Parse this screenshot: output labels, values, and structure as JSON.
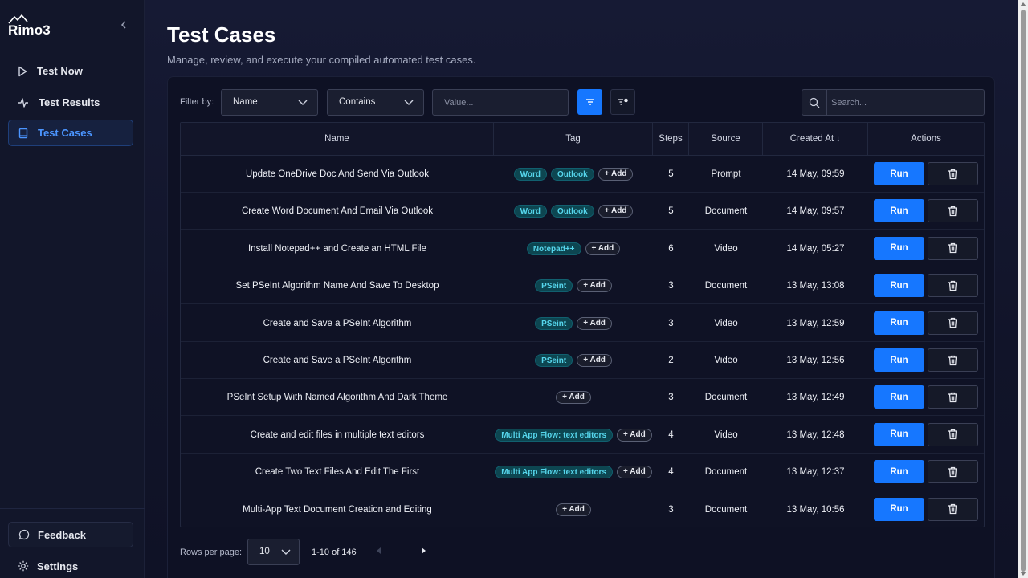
{
  "app": {
    "logo_text": "Rimo3"
  },
  "sidebar": {
    "items": [
      {
        "label": "Test Now",
        "icon": "play-icon"
      },
      {
        "label": "Test Results",
        "icon": "activity-icon"
      },
      {
        "label": "Test Cases",
        "icon": "book-icon",
        "active": true
      }
    ],
    "feedback_label": "Feedback",
    "settings_label": "Settings"
  },
  "header": {
    "title": "Test Cases",
    "subtitle": "Manage, review, and execute your compiled automated test cases."
  },
  "filter": {
    "label": "Filter by:",
    "field_value": "Name",
    "operator_value": "Contains",
    "value_placeholder": "Value...",
    "search_placeholder": "Search..."
  },
  "table": {
    "columns": [
      "Name",
      "Tag",
      "Steps",
      "Source",
      "Created At",
      "Actions"
    ],
    "sort_indicator": "↓",
    "add_tag_label": "+ Add",
    "run_label": "Run",
    "rows": [
      {
        "name": "Update OneDrive Doc And Send Via Outlook",
        "tags": [
          "Word",
          "Outlook"
        ],
        "steps": "5",
        "source": "Prompt",
        "created": "14 May, 09:59"
      },
      {
        "name": "Create Word Document And Email Via Outlook",
        "tags": [
          "Word",
          "Outlook"
        ],
        "steps": "5",
        "source": "Document",
        "created": "14 May, 09:57"
      },
      {
        "name": "Install Notepad++ and Create an HTML File",
        "tags": [
          "Notepad++"
        ],
        "steps": "6",
        "source": "Video",
        "created": "14 May, 05:27"
      },
      {
        "name": "Set PSeInt Algorithm Name And Save To Desktop",
        "tags": [
          "PSeint"
        ],
        "steps": "3",
        "source": "Document",
        "created": "13 May, 13:08"
      },
      {
        "name": "Create and Save a PSeInt Algorithm",
        "tags": [
          "PSeint"
        ],
        "steps": "3",
        "source": "Video",
        "created": "13 May, 12:59"
      },
      {
        "name": "Create and Save a PSeInt Algorithm",
        "tags": [
          "PSeint"
        ],
        "steps": "2",
        "source": "Video",
        "created": "13 May, 12:56"
      },
      {
        "name": "PSeInt Setup With Named Algorithm And Dark Theme",
        "tags": [],
        "steps": "3",
        "source": "Document",
        "created": "13 May, 12:49"
      },
      {
        "name": "Create and edit files in multiple text editors",
        "tags": [
          "Multi App Flow: text editors"
        ],
        "steps": "4",
        "source": "Video",
        "created": "13 May, 12:48"
      },
      {
        "name": "Create Two Text Files And Edit The First",
        "tags": [
          "Multi App Flow: text editors"
        ],
        "steps": "4",
        "source": "Document",
        "created": "13 May, 12:37"
      },
      {
        "name": "Multi-App Text Document Creation and Editing",
        "tags": [],
        "steps": "3",
        "source": "Document",
        "created": "13 May, 10:56"
      }
    ]
  },
  "pagination": {
    "rows_per_page_label": "Rows per page:",
    "rows_per_page_value": "10",
    "range_text": "1-10 of 146"
  },
  "colors": {
    "accent": "#1677ff",
    "tag_bg": "#0d4651",
    "tag_text": "#56d6ec",
    "active_nav": "#4b95ff"
  }
}
